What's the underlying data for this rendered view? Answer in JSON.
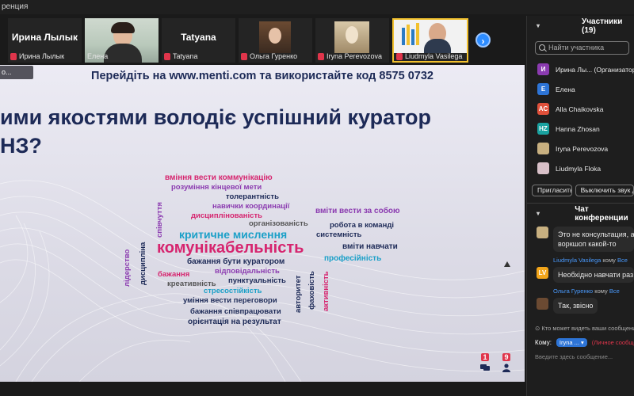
{
  "window": {
    "title_fragment": "ренция"
  },
  "video_strip": {
    "tiles": [
      {
        "big_name": "Ирина Лылык",
        "label": "Ирина Лылык",
        "muted": true
      },
      {
        "big_name": "",
        "label": "Елена",
        "muted": false
      },
      {
        "big_name": "Tatyana",
        "label": "Tatyana",
        "muted": true
      },
      {
        "big_name": "",
        "label": "Ольга Гуренко",
        "muted": true
      },
      {
        "big_name": "",
        "label": "Iryna Perevozova",
        "muted": true
      },
      {
        "big_name": "",
        "label": "Liudmyla Vasilega",
        "muted": true
      }
    ],
    "next_icon": "chevron-right-icon",
    "next_glyph": "›"
  },
  "share": {
    "view_label": "о...",
    "banner_prefix": "Перейдіть на",
    "banner_site": "www.menti.com",
    "banner_mid": "та використайте код",
    "banner_code": "8575 0732",
    "question_line1": "ими якостями володіє успішний куратор",
    "question_line2": "НЗ?",
    "word_cloud": [
      {
        "text": "вміння вести коммунікацію",
        "color": "#d6246e"
      },
      {
        "text": "розуміння кінцевої мети",
        "color": "#8b3bb0"
      },
      {
        "text": "толерантність",
        "color": "#1d2a57"
      },
      {
        "text": "навички координації",
        "color": "#8b3bb0"
      },
      {
        "text": "дисциплінованість",
        "color": "#d6246e"
      },
      {
        "text": "організованість",
        "color": "#555555"
      },
      {
        "text": "вміти вести за собою",
        "color": "#8b3bb0"
      },
      {
        "text": "критичне мислення",
        "color": "#1ba0c8"
      },
      {
        "text": "робота в команді",
        "color": "#1d2a57"
      },
      {
        "text": "системність",
        "color": "#1d2a57"
      },
      {
        "text": "комунікабельність",
        "color": "#d6246e"
      },
      {
        "text": "вміти навчати",
        "color": "#1d2a57"
      },
      {
        "text": "бажання бути куратором",
        "color": "#1d2a57"
      },
      {
        "text": "професійність",
        "color": "#1ba0c8"
      },
      {
        "text": "відповідальність",
        "color": "#8b3bb0"
      },
      {
        "text": "бажання",
        "color": "#d6246e"
      },
      {
        "text": "пунктуальність",
        "color": "#1d2a57"
      },
      {
        "text": "креативність",
        "color": "#555555"
      },
      {
        "text": "стресостійкість",
        "color": "#1ba0c8"
      },
      {
        "text": "уміння вести переговори",
        "color": "#1d2a57"
      },
      {
        "text": "бажання співпрацювати",
        "color": "#1d2a57"
      },
      {
        "text": "орієнтація на результат",
        "color": "#1d2a57"
      },
      {
        "text": "співчуття",
        "color": "#8b3bb0"
      },
      {
        "text": "лідерство",
        "color": "#8b3bb0"
      },
      {
        "text": "дисципліна",
        "color": "#1d2a57"
      },
      {
        "text": "авторитет",
        "color": "#1d2a57"
      },
      {
        "text": "фаховість",
        "color": "#1d2a57"
      },
      {
        "text": "активність",
        "color": "#d6246e"
      }
    ],
    "counter_comments": "1",
    "counter_people": "9"
  },
  "participants": {
    "header": "Участники (19)",
    "search_placeholder": "Найти участника",
    "list": [
      {
        "initials": "И",
        "name": "Ирина Лы... (Организатор, я)",
        "color": "#8b3bb0"
      },
      {
        "initials": "Е",
        "name": "Елена",
        "color": "#2d74d6"
      },
      {
        "initials": "AC",
        "name": "Alla Chaikovska",
        "color": "#e0503a"
      },
      {
        "initials": "HZ",
        "name": "Hanna Zhosan",
        "color": "#1aa2a0"
      },
      {
        "initials": "",
        "name": "Iryna Perevozova",
        "color": "#c8b080"
      },
      {
        "initials": "",
        "name": "Liudmyla Floka",
        "color": "#d8c0c8"
      }
    ],
    "invite_label": "Пригласить",
    "mute_all_label": "Выключить звук дл"
  },
  "chat": {
    "header": "Чат конференции",
    "messages": [
      {
        "sender": "",
        "to": "",
        "text_l1": "Это не консультация, а",
        "text_l2": "воркшоп какой-то"
      },
      {
        "sender": "Liudmyla Vasilega",
        "to_word": "кому",
        "to": "Все",
        "initials": "LV",
        "text_l1": "Необхідно навчати раз"
      },
      {
        "sender": "Ольга Гуренко",
        "to_word": "кому",
        "to": "Все",
        "text_l1": "Так, звісно"
      }
    ],
    "visibility_note": "Кто может видеть ваши сообщени",
    "to_label": "Кому:",
    "to_value": "Iryna ...",
    "private_label": "(Личное сообщен",
    "input_placeholder": "Введите здесь сообщение..."
  }
}
